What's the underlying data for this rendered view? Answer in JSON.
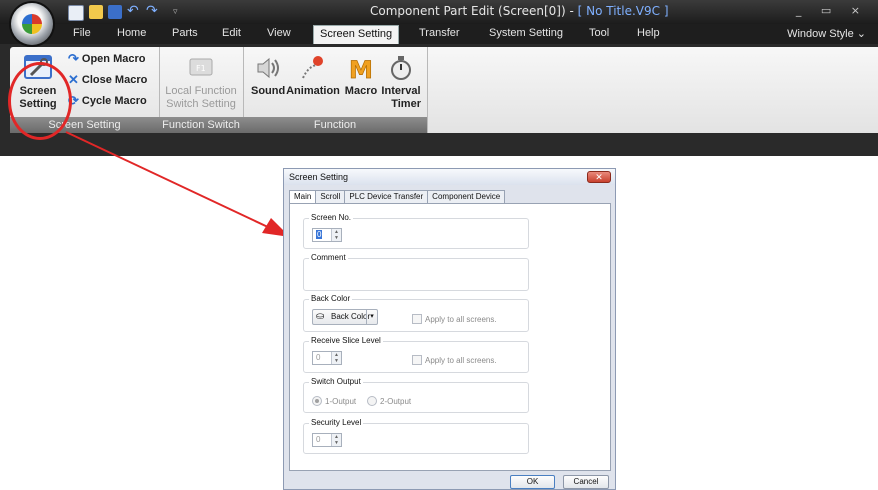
{
  "app": {
    "title_prefix": "Component Part Edit (Screen[0]) - ",
    "title_file": "[ No Title.V9C ]",
    "window_controls": "_ ▭ ×"
  },
  "ribbon_tabs": [
    "File",
    "Home",
    "Parts",
    "Edit",
    "View",
    "Screen Setting",
    "Transfer",
    "System Setting",
    "Tool",
    "Help"
  ],
  "active_tab": "Screen Setting",
  "window_style": "Window Style ⌄",
  "ribbon": {
    "screen_setting_group": {
      "label": "Screen Setting",
      "big_button": "Screen Setting",
      "big_button_line1": "Screen",
      "big_button_line2": "Setting",
      "open_macro": "Open Macro",
      "close_macro": "Close Macro",
      "cycle_macro": "Cycle Macro"
    },
    "function_switch_group": {
      "label": "Function Switch",
      "btn_line1": "Local Function",
      "btn_line2": "Switch Setting"
    },
    "function_group": {
      "label": "Function",
      "sound": "Sound",
      "animation": "Animation",
      "macro": "Macro",
      "interval_line1": "Interval",
      "interval_line2": "Timer"
    }
  },
  "dialog": {
    "title": "Screen Setting",
    "close": "✕",
    "tabs": [
      "Main",
      "Scroll",
      "PLC Device Transfer",
      "Component Device"
    ],
    "active_tab": "Main",
    "screen_no": {
      "label": "Screen No.",
      "value": "0"
    },
    "comment": {
      "label": "Comment",
      "value": ""
    },
    "back_color": {
      "label": "Back Color",
      "button": "Back Color",
      "apply_all": "Apply to all screens."
    },
    "receive_slice": {
      "label": "Receive Slice Level",
      "value": "0",
      "apply_all": "Apply to all screens."
    },
    "switch_output": {
      "label": "Switch Output",
      "option1": "1-Output",
      "option2": "2-Output",
      "selected": "1-Output"
    },
    "security_level": {
      "label": "Security Level",
      "value": "0"
    },
    "ok": "OK",
    "cancel": "Cancel"
  },
  "colors": {
    "highlight": "#e12727",
    "titlebar": "#2a2a2a",
    "ribbon_body": "#eeeeee",
    "dialog_bg": "#dfe3ec"
  }
}
